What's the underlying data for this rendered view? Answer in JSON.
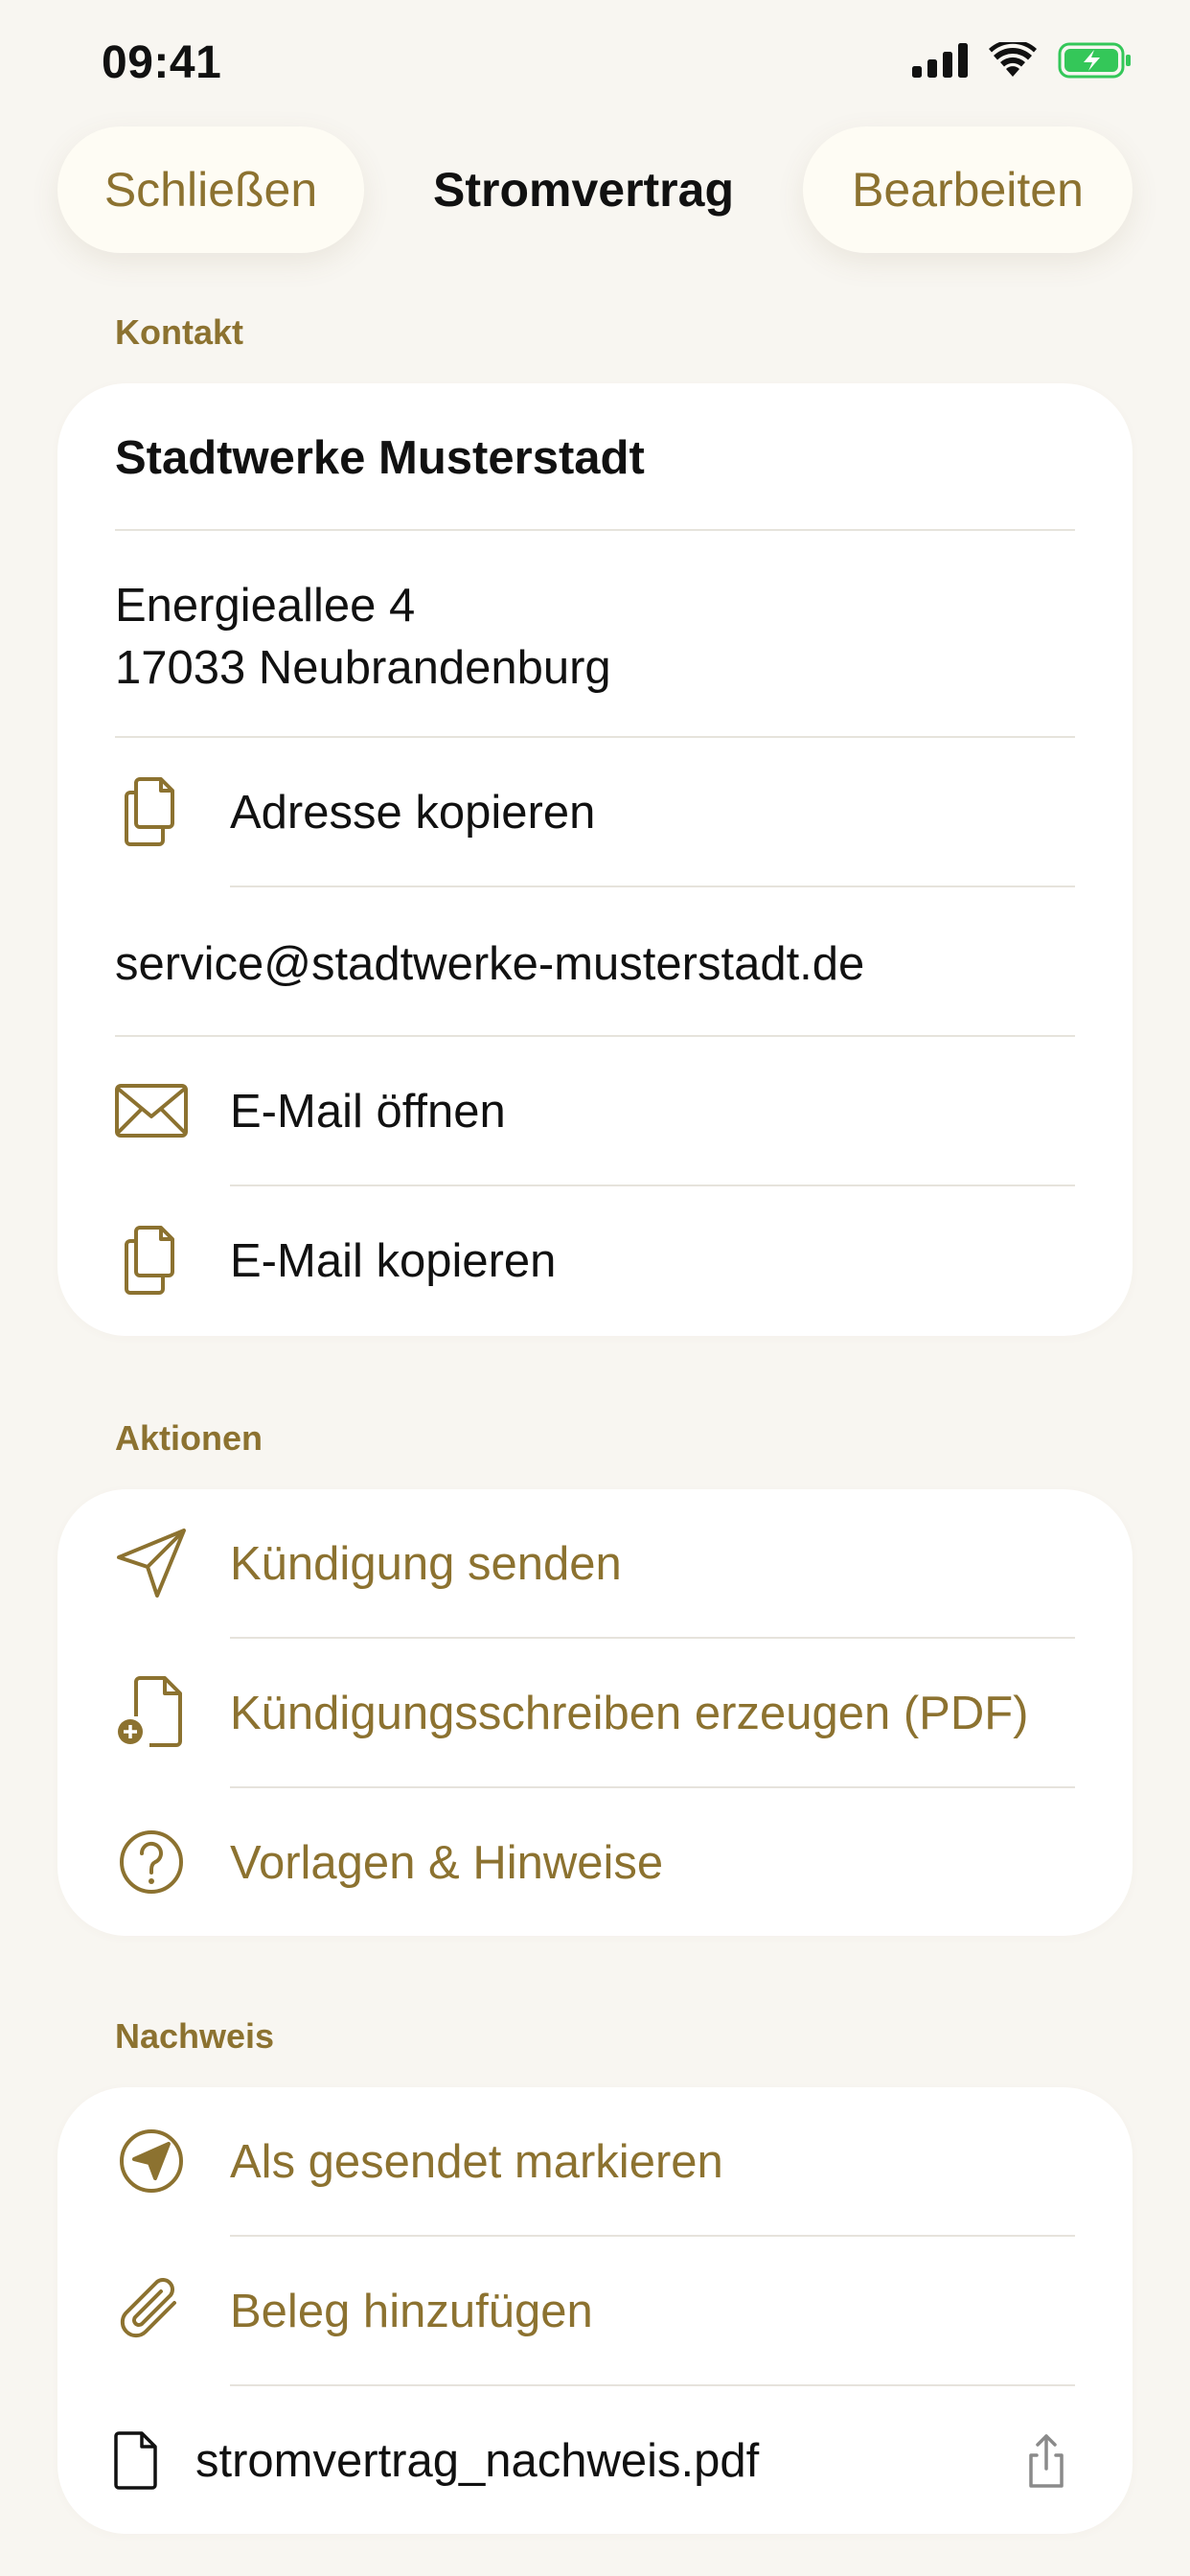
{
  "status_bar": {
    "time": "09:41",
    "icons": [
      "signal-icon",
      "wifi-icon",
      "battery-charging-icon"
    ],
    "battery_color": "#34C759"
  },
  "nav": {
    "close_label": "Schließen",
    "title": "Stromvertrag",
    "edit_label": "Bearbeiten"
  },
  "colors": {
    "accent": "#8C7230",
    "background": "#F8F6F1",
    "card": "#FFFFFF"
  },
  "contact": {
    "section_label": "Kontakt",
    "name": "Stadtwerke Musterstadt",
    "address_line1": "Energieallee 4",
    "address_line2": "17033 Neubrandenburg",
    "copy_address_label": "Adresse kopieren",
    "email": "service@stadtwerke-musterstadt.de",
    "open_email_label": "E-Mail öffnen",
    "copy_email_label": "E-Mail kopieren"
  },
  "actions": {
    "section_label": "Aktionen",
    "items": [
      {
        "label": "Kündigung senden",
        "icon": "paper-plane-icon"
      },
      {
        "label": "Kündigungsschreiben erzeugen (PDF)",
        "icon": "document-add-icon"
      },
      {
        "label": "Vorlagen & Hinweise",
        "icon": "question-circle-icon"
      }
    ]
  },
  "proof": {
    "section_label": "Nachweis",
    "mark_sent_label": "Als gesendet markieren",
    "add_receipt_label": "Beleg hinzufügen",
    "file_name": "stromvertrag_nachweis.pdf"
  }
}
